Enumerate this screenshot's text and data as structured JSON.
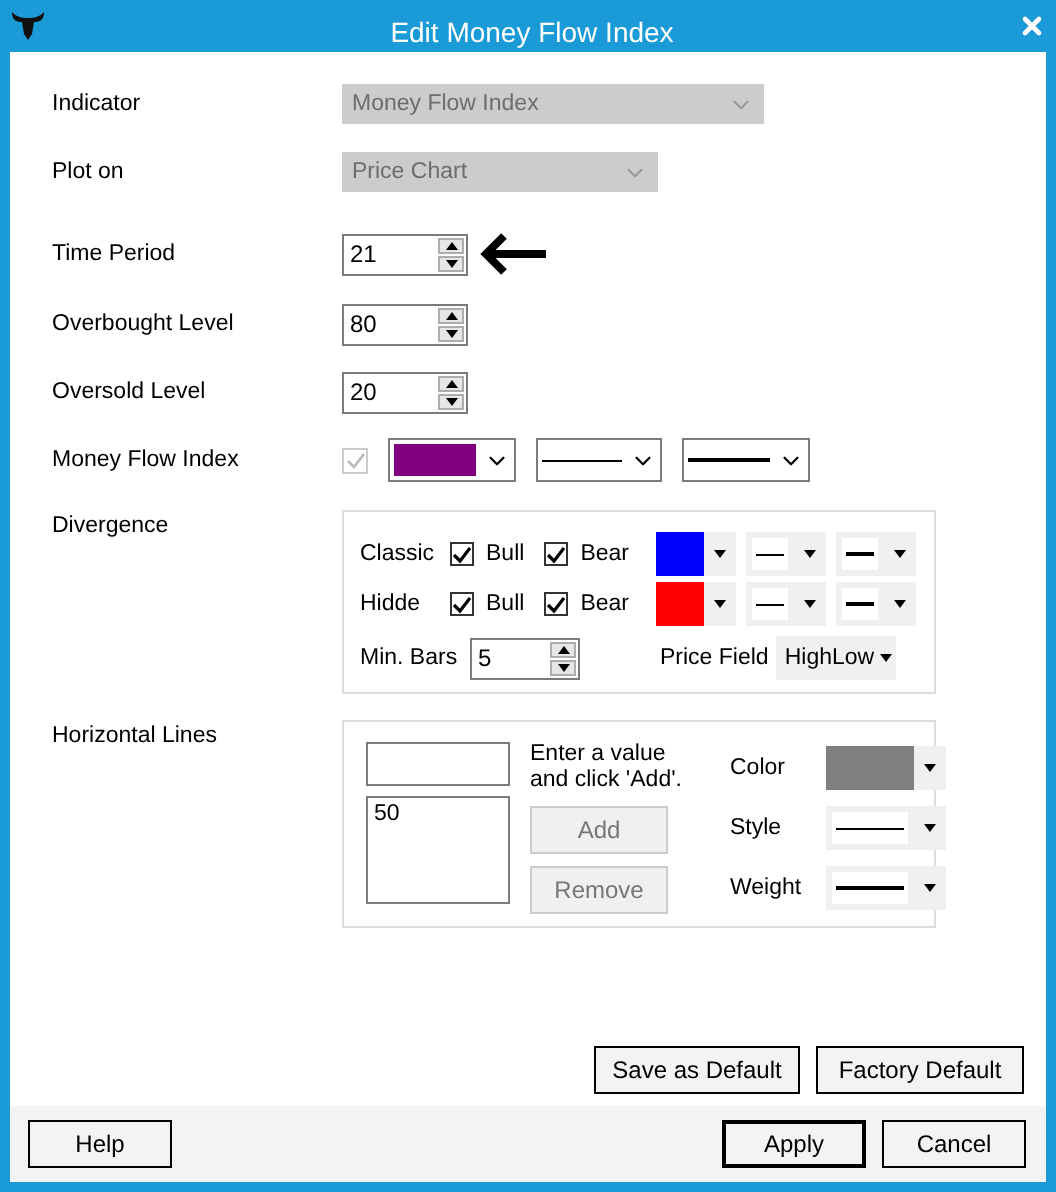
{
  "window": {
    "title": "Edit Money Flow Index"
  },
  "indicator": {
    "label": "Indicator",
    "value": "Money Flow Index",
    "disabled": true
  },
  "plot_on": {
    "label": "Plot on",
    "value": "Price Chart",
    "disabled": true
  },
  "spinners": [
    {
      "label": "Time Period",
      "value": "21",
      "annotated": true
    },
    {
      "label": "Overbought Level",
      "value": "80",
      "annotated": false
    },
    {
      "label": "Oversold Level",
      "value": "20",
      "annotated": false
    }
  ],
  "line": {
    "label": "Money Flow Index",
    "checked": true,
    "disabled": true,
    "color": "#800080"
  },
  "divergence": {
    "label": "Divergence",
    "rows": [
      {
        "label": "Classic",
        "bull": {
          "label": "Bull",
          "checked": true
        },
        "bear": {
          "label": "Bear",
          "checked": true
        },
        "color": "#0000ff"
      },
      {
        "label": "Hidde",
        "bull": {
          "label": "Bull",
          "checked": true
        },
        "bear": {
          "label": "Bear",
          "checked": true
        },
        "color": "#ff0000"
      }
    ],
    "min_bars": {
      "label": "Min. Bars",
      "value": "5"
    },
    "price_field": {
      "label": "Price Field",
      "value": "HighLow"
    }
  },
  "horizontal_lines": {
    "label": "Horizontal Lines",
    "hint": "Enter a value and click 'Add'.",
    "values": [
      "50"
    ],
    "buttons": [
      {
        "label": "Add",
        "disabled": true
      },
      {
        "label": "Remove",
        "disabled": true
      }
    ],
    "color_label": "Color",
    "color": "#808080",
    "style_label": "Style",
    "weight_label": "Weight"
  },
  "default_buttons": [
    "Save as Default",
    "Factory Default"
  ],
  "footer": {
    "help": "Help",
    "buttons": [
      {
        "label": "Apply",
        "default": true
      },
      {
        "label": "Cancel",
        "default": false
      }
    ]
  }
}
